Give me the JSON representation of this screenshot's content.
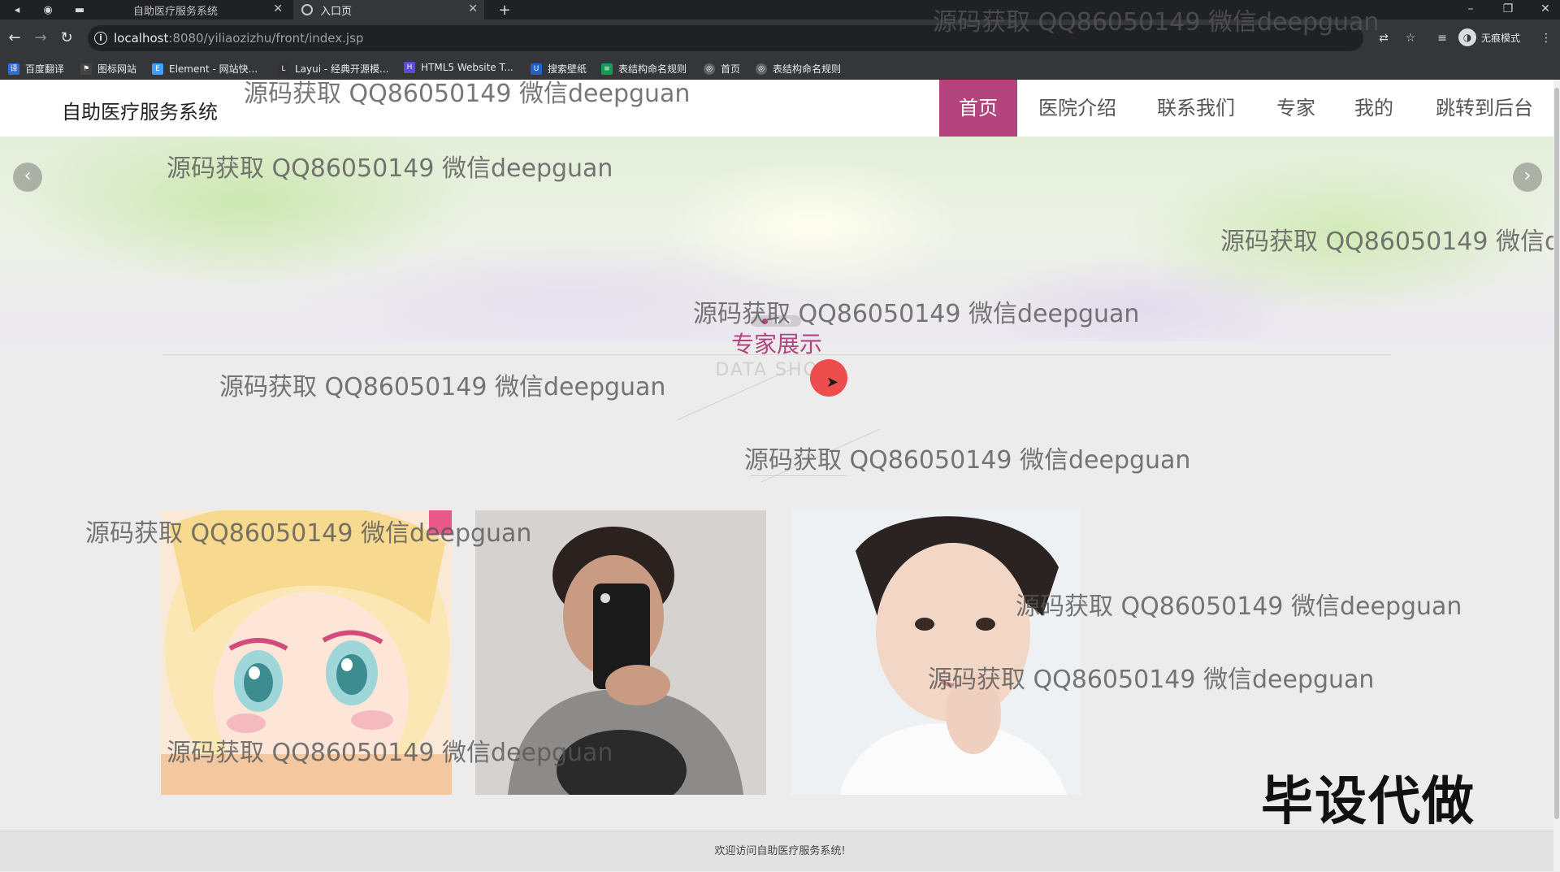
{
  "browser": {
    "tabs": [
      {
        "label": "自助医疗服务系统",
        "active": false
      },
      {
        "label": "入口页",
        "active": true
      }
    ],
    "new_tab": "+",
    "url_host": "localhost",
    "url_path": ":8080/yiliaozizhu/front/index.jsp",
    "profile_label": "无痕模式",
    "bookmarks": [
      {
        "label": "百度翻译",
        "color": "#2b6fe0"
      },
      {
        "label": "图标网站",
        "color": "#444444"
      },
      {
        "label": "Element - 网站快...",
        "color": "#409eff"
      },
      {
        "label": "Layui - 经典开源模...",
        "color": "#333333"
      },
      {
        "label": "HTML5 Website T...",
        "color": "#5b4bd6"
      },
      {
        "label": "搜索壁纸",
        "color": "#1e63c9"
      },
      {
        "label": "表结构命名规则",
        "color": "#0f9d58"
      },
      {
        "label": "首页",
        "color": "#5f6368"
      },
      {
        "label": "表结构命名规则",
        "color": "#5f6368"
      }
    ]
  },
  "site": {
    "brand": "自助医疗服务系统",
    "nav": [
      "首页",
      "医院介绍",
      "联系我们",
      "专家",
      "我的",
      "跳转到后台"
    ],
    "nav_active_color": "#b3447e",
    "banner_prev": "‹",
    "banner_next": "›",
    "section_title": "专家展示",
    "section_subtitle": "DATA SHOW",
    "footer": "欢迎访问自助医疗服务系统!",
    "overlay_text": "毕设代做"
  },
  "watermark": "源码获取 QQ86050149 微信deepguan",
  "experts": [
    {
      "image": "anime-girl-avatar"
    },
    {
      "image": "man-mirror-selfie"
    },
    {
      "image": "young-man-portrait"
    }
  ]
}
